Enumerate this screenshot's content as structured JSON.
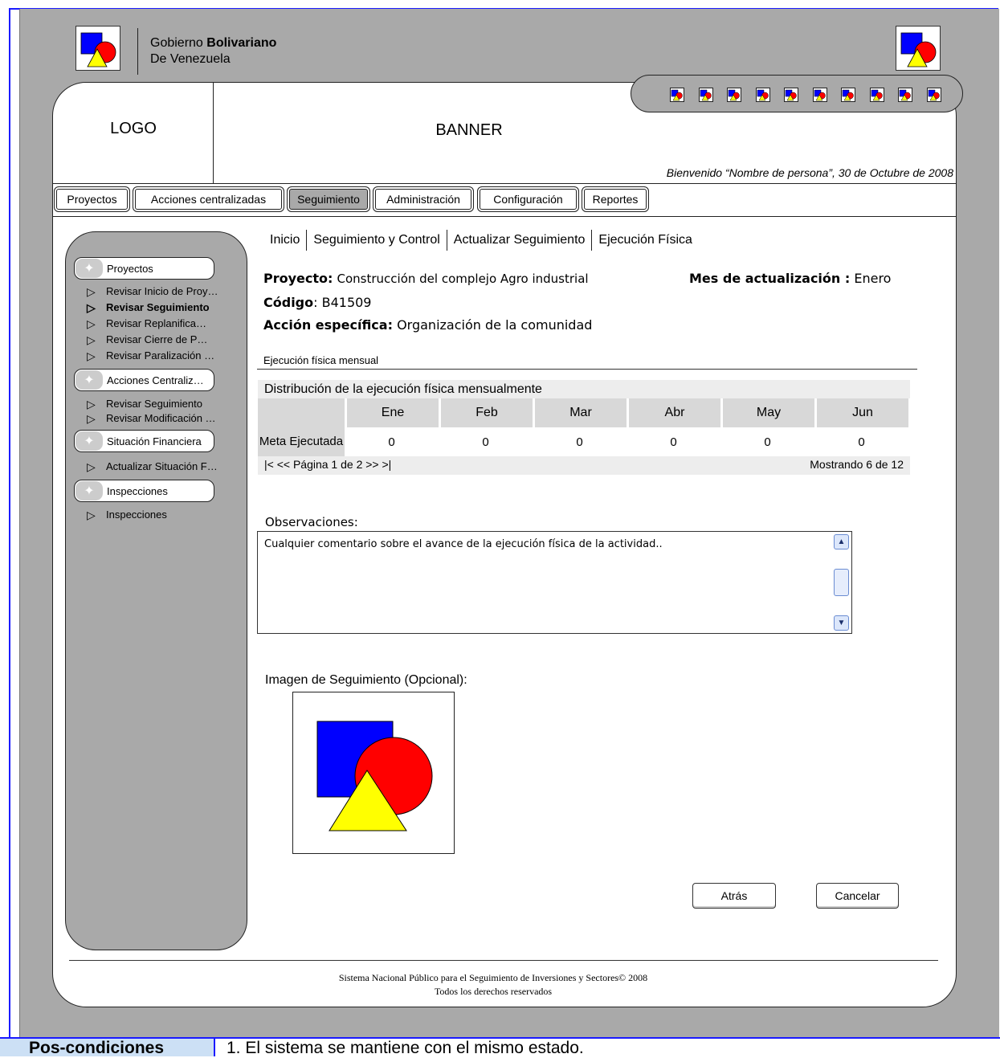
{
  "header": {
    "gov_line1_prefix": "Gobierno",
    "gov_line1_bold": "Bolivariano",
    "gov_line2": "De Venezuela"
  },
  "card": {
    "logo": "LOGO",
    "banner": "BANNER",
    "welcome": "Bienvenido “Nombre de persona”, 30 de Octubre de 2008"
  },
  "tabs": [
    {
      "label": "Proyectos"
    },
    {
      "label": "Acciones centralizadas"
    },
    {
      "label": "Seguimiento",
      "active": true
    },
    {
      "label": "Administración"
    },
    {
      "label": "Configuración"
    },
    {
      "label": "Reportes"
    }
  ],
  "sidebar": {
    "groups": [
      {
        "label": "Proyectos",
        "items": [
          "Revisar Inicio de Proy…",
          "Revisar Seguimiento",
          "Revisar Replanifica…",
          "Revisar Cierre de P…",
          "Revisar Paralización …"
        ]
      },
      {
        "label": "Acciones Centraliz…",
        "items": [
          "Revisar Seguimiento",
          "Revisar Modificación …"
        ]
      },
      {
        "label": "Situación Financiera",
        "items": [
          "Actualizar Situación F…"
        ]
      },
      {
        "label": "Inspecciones",
        "items": [
          "Inspecciones"
        ]
      }
    ]
  },
  "breadcrumb": [
    "Inicio",
    "Seguimiento y Control",
    "Actualizar Seguimiento",
    "Ejecución Física"
  ],
  "info": {
    "proyecto_label": "Proyecto:",
    "proyecto_value": "Construcción del complejo Agro industrial",
    "mes_label": "Mes de actualización :",
    "mes_value": "Enero",
    "codigo_label": "Código",
    "codigo_value": ": B41509",
    "accion_label": "Acción específica:",
    "accion_value": "Organización de la comunidad"
  },
  "section_title": "Ejecución física mensual",
  "table": {
    "title": "Distribución de la ejecución física mensualmente",
    "months": [
      "Ene",
      "Feb",
      "Mar",
      "Abr",
      "May",
      "Jun"
    ],
    "row_label": "Meta Ejecutada",
    "values": [
      "0",
      "0",
      "0",
      "0",
      "0",
      "0"
    ],
    "pager": "|<  << Página 1 de 2 >>  >|",
    "showing": "Mostrando 6 de 12"
  },
  "observaciones": {
    "label": "Observaciones:",
    "text": "Cualquier comentario sobre el avance de la ejecución física de la actividad.."
  },
  "image_label": "Imagen de Seguimiento  (Opcional):",
  "buttons": {
    "back": "Atrás",
    "cancel": "Cancelar"
  },
  "footer": {
    "line1": "Sistema Nacional Público para el Seguimiento de Inversiones y Sectores© 2008",
    "line2": "Todos los derechos reservados"
  },
  "postconditions": {
    "label": "Pos-condiciones",
    "text": "1.   El sistema se mantiene con el mismo estado."
  },
  "colors": {
    "blue": "#0000ff",
    "red": "#ff0000",
    "yellow": "#ffff00",
    "gray": "#a9a9a9"
  }
}
